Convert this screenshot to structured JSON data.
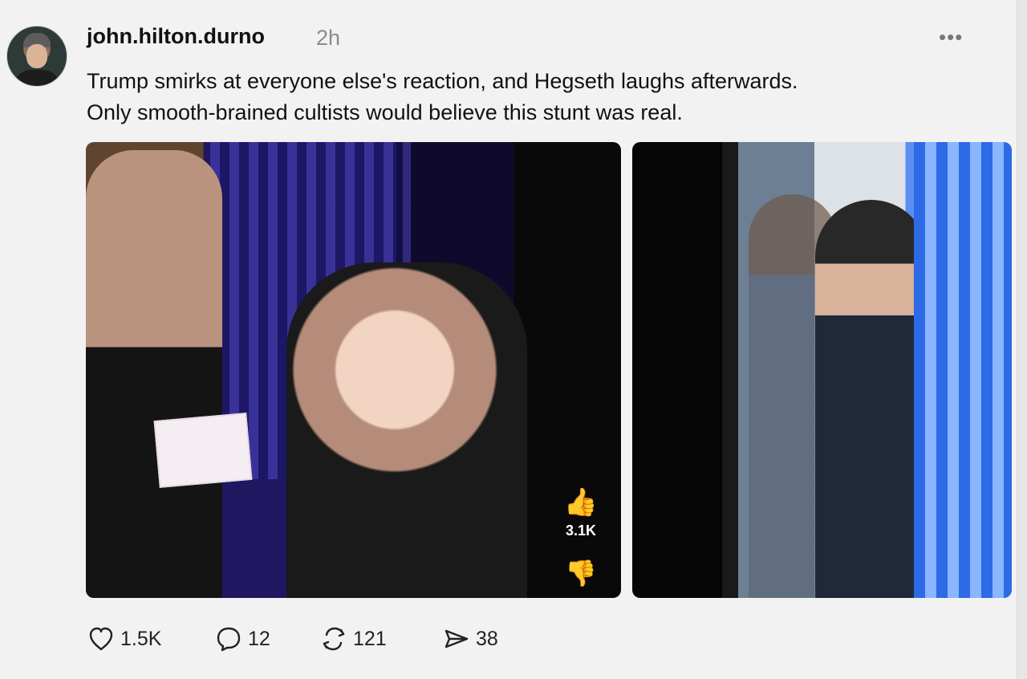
{
  "post": {
    "username": "john.hilton.durno",
    "timestamp": "2h",
    "more_label": "•••",
    "text": "Trump smirks at everyone else's reaction, and Hegseth laughs afterwards.\nOnly smooth-brained cultists would believe this stunt was real."
  },
  "media": {
    "video_overlay": {
      "thumb_up_icon": "thumbs-up-icon",
      "thumb_up_label": "👍",
      "thumb_up_count": "3.1K",
      "thumb_down_icon": "thumbs-down-icon",
      "thumb_down_label": "👎"
    }
  },
  "actions": {
    "likes": "1.5K",
    "replies": "12",
    "reposts": "121",
    "shares": "38"
  }
}
